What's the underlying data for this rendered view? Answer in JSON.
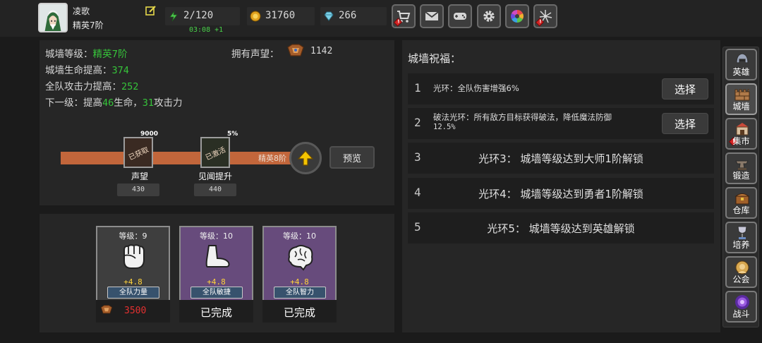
{
  "player": {
    "name": "凌歌",
    "rank": "精英7阶"
  },
  "resources": {
    "energy": "2/120",
    "energy_timer": "03:08 +1",
    "gold": "31760",
    "gems": "266"
  },
  "top_buttons": [
    {
      "icon": "shop-cart-icon",
      "badge": true
    },
    {
      "icon": "mail-icon",
      "badge": false
    },
    {
      "icon": "gamepad-icon",
      "badge": false
    },
    {
      "icon": "gear-icon",
      "badge": false
    },
    {
      "icon": "color-wheel-icon",
      "badge": false
    },
    {
      "icon": "fireworks-icon",
      "badge": true
    }
  ],
  "wall": {
    "level_label": "城墙等级：",
    "level_value": "精英7阶",
    "hp_label": "城墙生命提高：",
    "hp_value": "374",
    "atk_label": "全队攻击力提高：",
    "atk_value": "252",
    "next_prefix": "下一级：提高",
    "next_hp": "46",
    "next_mid": "生命，",
    "next_atk": "31",
    "next_suffix": "攻击力",
    "prestige_label": "拥有声望：",
    "prestige_value": "1142",
    "progress_label": "精英8阶",
    "nodes": [
      {
        "top": "9000",
        "stamp": "已获取",
        "name": "声望",
        "value": "430"
      },
      {
        "top": "5%",
        "stamp": "已激活",
        "name": "见闻提升",
        "value": "440"
      }
    ],
    "preview_label": "预览"
  },
  "skills": [
    {
      "level": "等级：9",
      "bonus": "+4.8",
      "name": "全队力量",
      "cost": "3500",
      "done": null,
      "style": "gray",
      "icon": "fist-icon"
    },
    {
      "level": "等级：10",
      "bonus": "+4.8",
      "name": "全队敏捷",
      "cost": null,
      "done": "已完成",
      "style": "purple",
      "icon": "foot-icon"
    },
    {
      "level": "等级：10",
      "bonus": "+4.8",
      "name": "全队智力",
      "cost": null,
      "done": "已完成",
      "style": "purple",
      "icon": "brain-icon"
    }
  ],
  "blessing": {
    "title": "城墙祝福：",
    "halos": [
      {
        "num": "1",
        "desc": "光环：全队伤害增强6%",
        "button": "选择"
      },
      {
        "num": "2",
        "desc": "破法光环：所有敌方目标获得破法，降低魔法防御",
        "desc2": "12.5%",
        "button": "选择"
      },
      {
        "num": "3",
        "lock": "光环3：  城墙等级达到大师1阶解锁"
      },
      {
        "num": "4",
        "lock": "光环4：  城墙等级达到勇者1阶解锁"
      },
      {
        "num": "5",
        "lock": "光环5：  城墙等级达到英雄解锁"
      }
    ]
  },
  "sidebar": [
    {
      "label": "英雄",
      "icon": "helmet-icon",
      "badge": false
    },
    {
      "label": "城墙",
      "icon": "wall-icon",
      "badge": false,
      "active": true
    },
    {
      "label": "集市",
      "icon": "market-icon",
      "badge": true
    },
    {
      "label": "锻造",
      "icon": "anvil-icon",
      "badge": false
    },
    {
      "label": "仓库",
      "icon": "chest-icon",
      "badge": false
    },
    {
      "label": "培养",
      "icon": "trophy-icon",
      "badge": false
    },
    {
      "label": "公会",
      "icon": "guild-icon",
      "badge": false
    },
    {
      "label": "战斗",
      "icon": "portal-icon",
      "badge": false
    }
  ],
  "colors": {
    "accent_green": "#36c43a",
    "progress_orange": "#c2663b",
    "cost_red": "#e33030",
    "bonus_yellow": "#ffd23a"
  }
}
